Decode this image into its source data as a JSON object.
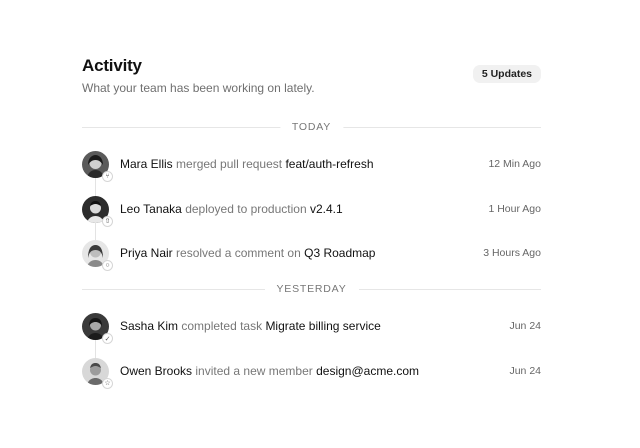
{
  "header": {
    "title": "Activity",
    "subtitle": "What your team has been working on lately.",
    "badge": "5 Updates"
  },
  "groups": [
    {
      "label": "TODAY",
      "items": [
        {
          "actor": "Mara Ellis",
          "action": "merged pull request",
          "target": "feat/auth-refresh",
          "time": "12 Min Ago",
          "icon": "merge-icon"
        },
        {
          "actor": "Leo Tanaka",
          "action": "deployed to production",
          "target": "v2.4.1",
          "time": "1 Hour Ago",
          "icon": "upload-icon"
        },
        {
          "actor": "Priya Nair",
          "action": "resolved a comment on",
          "target": "Q3 Roadmap",
          "time": "3 Hours Ago",
          "icon": "comment-icon"
        }
      ]
    },
    {
      "label": "YESTERDAY",
      "items": [
        {
          "actor": "Sasha Kim",
          "action": "completed task",
          "target": "Migrate billing service",
          "time": "Jun 24",
          "icon": "check-icon"
        },
        {
          "actor": "Owen Brooks",
          "action": "invited a new member",
          "target": "design@acme.com",
          "time": "Jun 24",
          "icon": "user-add-icon"
        }
      ]
    }
  ]
}
